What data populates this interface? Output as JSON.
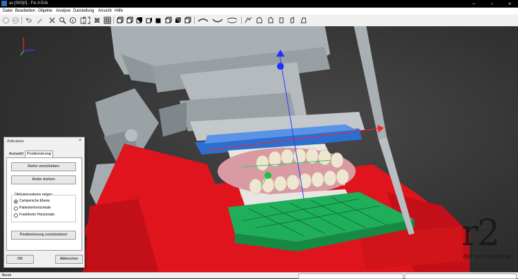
{
  "window": {
    "title": "as [000]0] - Fix it Erik"
  },
  "menu": [
    "Datei",
    "Bearbeiten",
    "Objekte",
    "Analyse",
    "Darstellung",
    "Ansicht",
    "Hilfe"
  ],
  "toolbar": {
    "icons": [
      "undo-disabled-icon",
      "redo-disabled-icon",
      "undo-icon",
      "edit-icon",
      "delete-icon",
      "zoom-icon",
      "info-icon",
      "delete-list-icon",
      "fit-icon",
      "select-icon",
      "grid-icon",
      "view-front-icon",
      "view-back-icon",
      "view-top-icon",
      "view-bottom-icon",
      "view-left-icon",
      "view-right-icon",
      "view-iso-icon",
      "cube-icon",
      "arch-icon",
      "arch-lower-icon",
      "articulator-icon",
      "tool-a-icon",
      "tool-b-icon",
      "tool-c-icon",
      "tool-d-icon",
      "tool-e-icon",
      "tool-f-icon"
    ]
  },
  "dialog": {
    "title": "Artikulator",
    "tabs": [
      "Auswahl",
      "Positionierung"
    ],
    "active_tab": "Positionierung",
    "buttons": {
      "move_jaw": "Kiefer verschieben",
      "rotate_jaw": "Kiefer drehen",
      "reset_position": "Positionierung zurücksetzen",
      "ok": "OK",
      "cancel": "Abbrechen"
    },
    "occlusal_group": {
      "title": "Okklusionsebene neigen",
      "options": [
        "Campersche Ebene",
        "Patientenhorizontale",
        "Frankfurter Horizontale"
      ],
      "selected_index": 0
    }
  },
  "status": {
    "text": "Bereit"
  },
  "watermark": {
    "big": "r2",
    "small": "dei ex machina"
  },
  "colors": {
    "articulator_red": "#e0141c",
    "occluder_green": "#1fae5a",
    "blue_ring": "#2c6fd0",
    "gray_body": "#a9b0b4"
  }
}
